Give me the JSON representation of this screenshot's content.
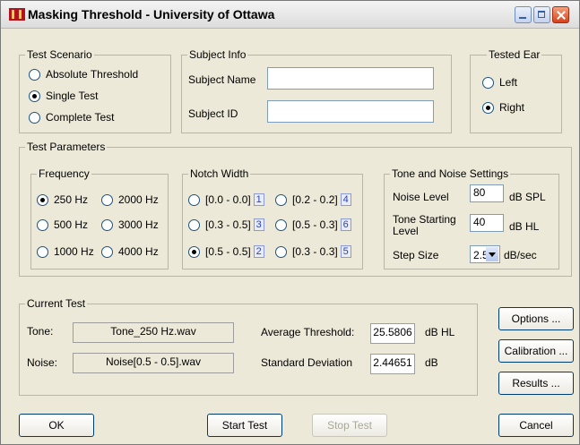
{
  "window": {
    "title": "Masking Threshold - University of Ottawa"
  },
  "test_scenario": {
    "legend": "Test Scenario",
    "options": [
      "Absolute Threshold",
      "Single Test",
      "Complete Test"
    ],
    "selected": "Single Test"
  },
  "subject_info": {
    "legend": "Subject Info",
    "name_label": "Subject Name",
    "name_value": "",
    "id_label": "Subject ID",
    "id_value": ""
  },
  "tested_ear": {
    "legend": "Tested Ear",
    "options": [
      "Left",
      "Right"
    ],
    "selected": "Right"
  },
  "test_parameters": {
    "legend": "Test Parameters",
    "frequency": {
      "legend": "Frequency",
      "options": [
        "250 Hz",
        "2000 Hz",
        "500 Hz",
        "3000 Hz",
        "1000 Hz",
        "4000 Hz"
      ],
      "selected": "250 Hz"
    },
    "notch_width": {
      "legend": "Notch Width",
      "options": [
        {
          "label": "[0.0 - 0.0]",
          "num": "1"
        },
        {
          "label": "[0.2 - 0.2]",
          "num": "4"
        },
        {
          "label": "[0.3 - 0.5]",
          "num": "3"
        },
        {
          "label": "[0.5 - 0.3]",
          "num": "6"
        },
        {
          "label": "[0.5 - 0.5]",
          "num": "2"
        },
        {
          "label": "[0.3 - 0.3]",
          "num": "5"
        }
      ],
      "selected": "[0.5 - 0.5]"
    },
    "tone_noise": {
      "legend": "Tone and Noise Settings",
      "noise_level_label": "Noise Level",
      "noise_level_value": "80",
      "noise_level_unit": "dB SPL",
      "tone_start_label_1": "Tone Starting",
      "tone_start_label_2": "Level",
      "tone_start_value": "40",
      "tone_start_unit": "dB HL",
      "step_size_label": "Step Size",
      "step_size_value": "2.5",
      "step_size_unit": "dB/sec"
    }
  },
  "current_test": {
    "legend": "Current Test",
    "tone_label": "Tone:",
    "tone_value": "Tone_250 Hz.wav",
    "noise_label": "Noise:",
    "noise_value": "Noise[0.5 - 0.5].wav",
    "avg_label": "Average Threshold:",
    "avg_value": "25.5806",
    "avg_unit": "dB HL",
    "sd_label": "Standard Deviation",
    "sd_value": "2.44651",
    "sd_unit": "dB"
  },
  "buttons": {
    "options": "Options ...",
    "calibration": "Calibration ...",
    "results": "Results ...",
    "ok": "OK",
    "start_test": "Start Test",
    "stop_test": "Stop Test",
    "cancel": "Cancel"
  }
}
